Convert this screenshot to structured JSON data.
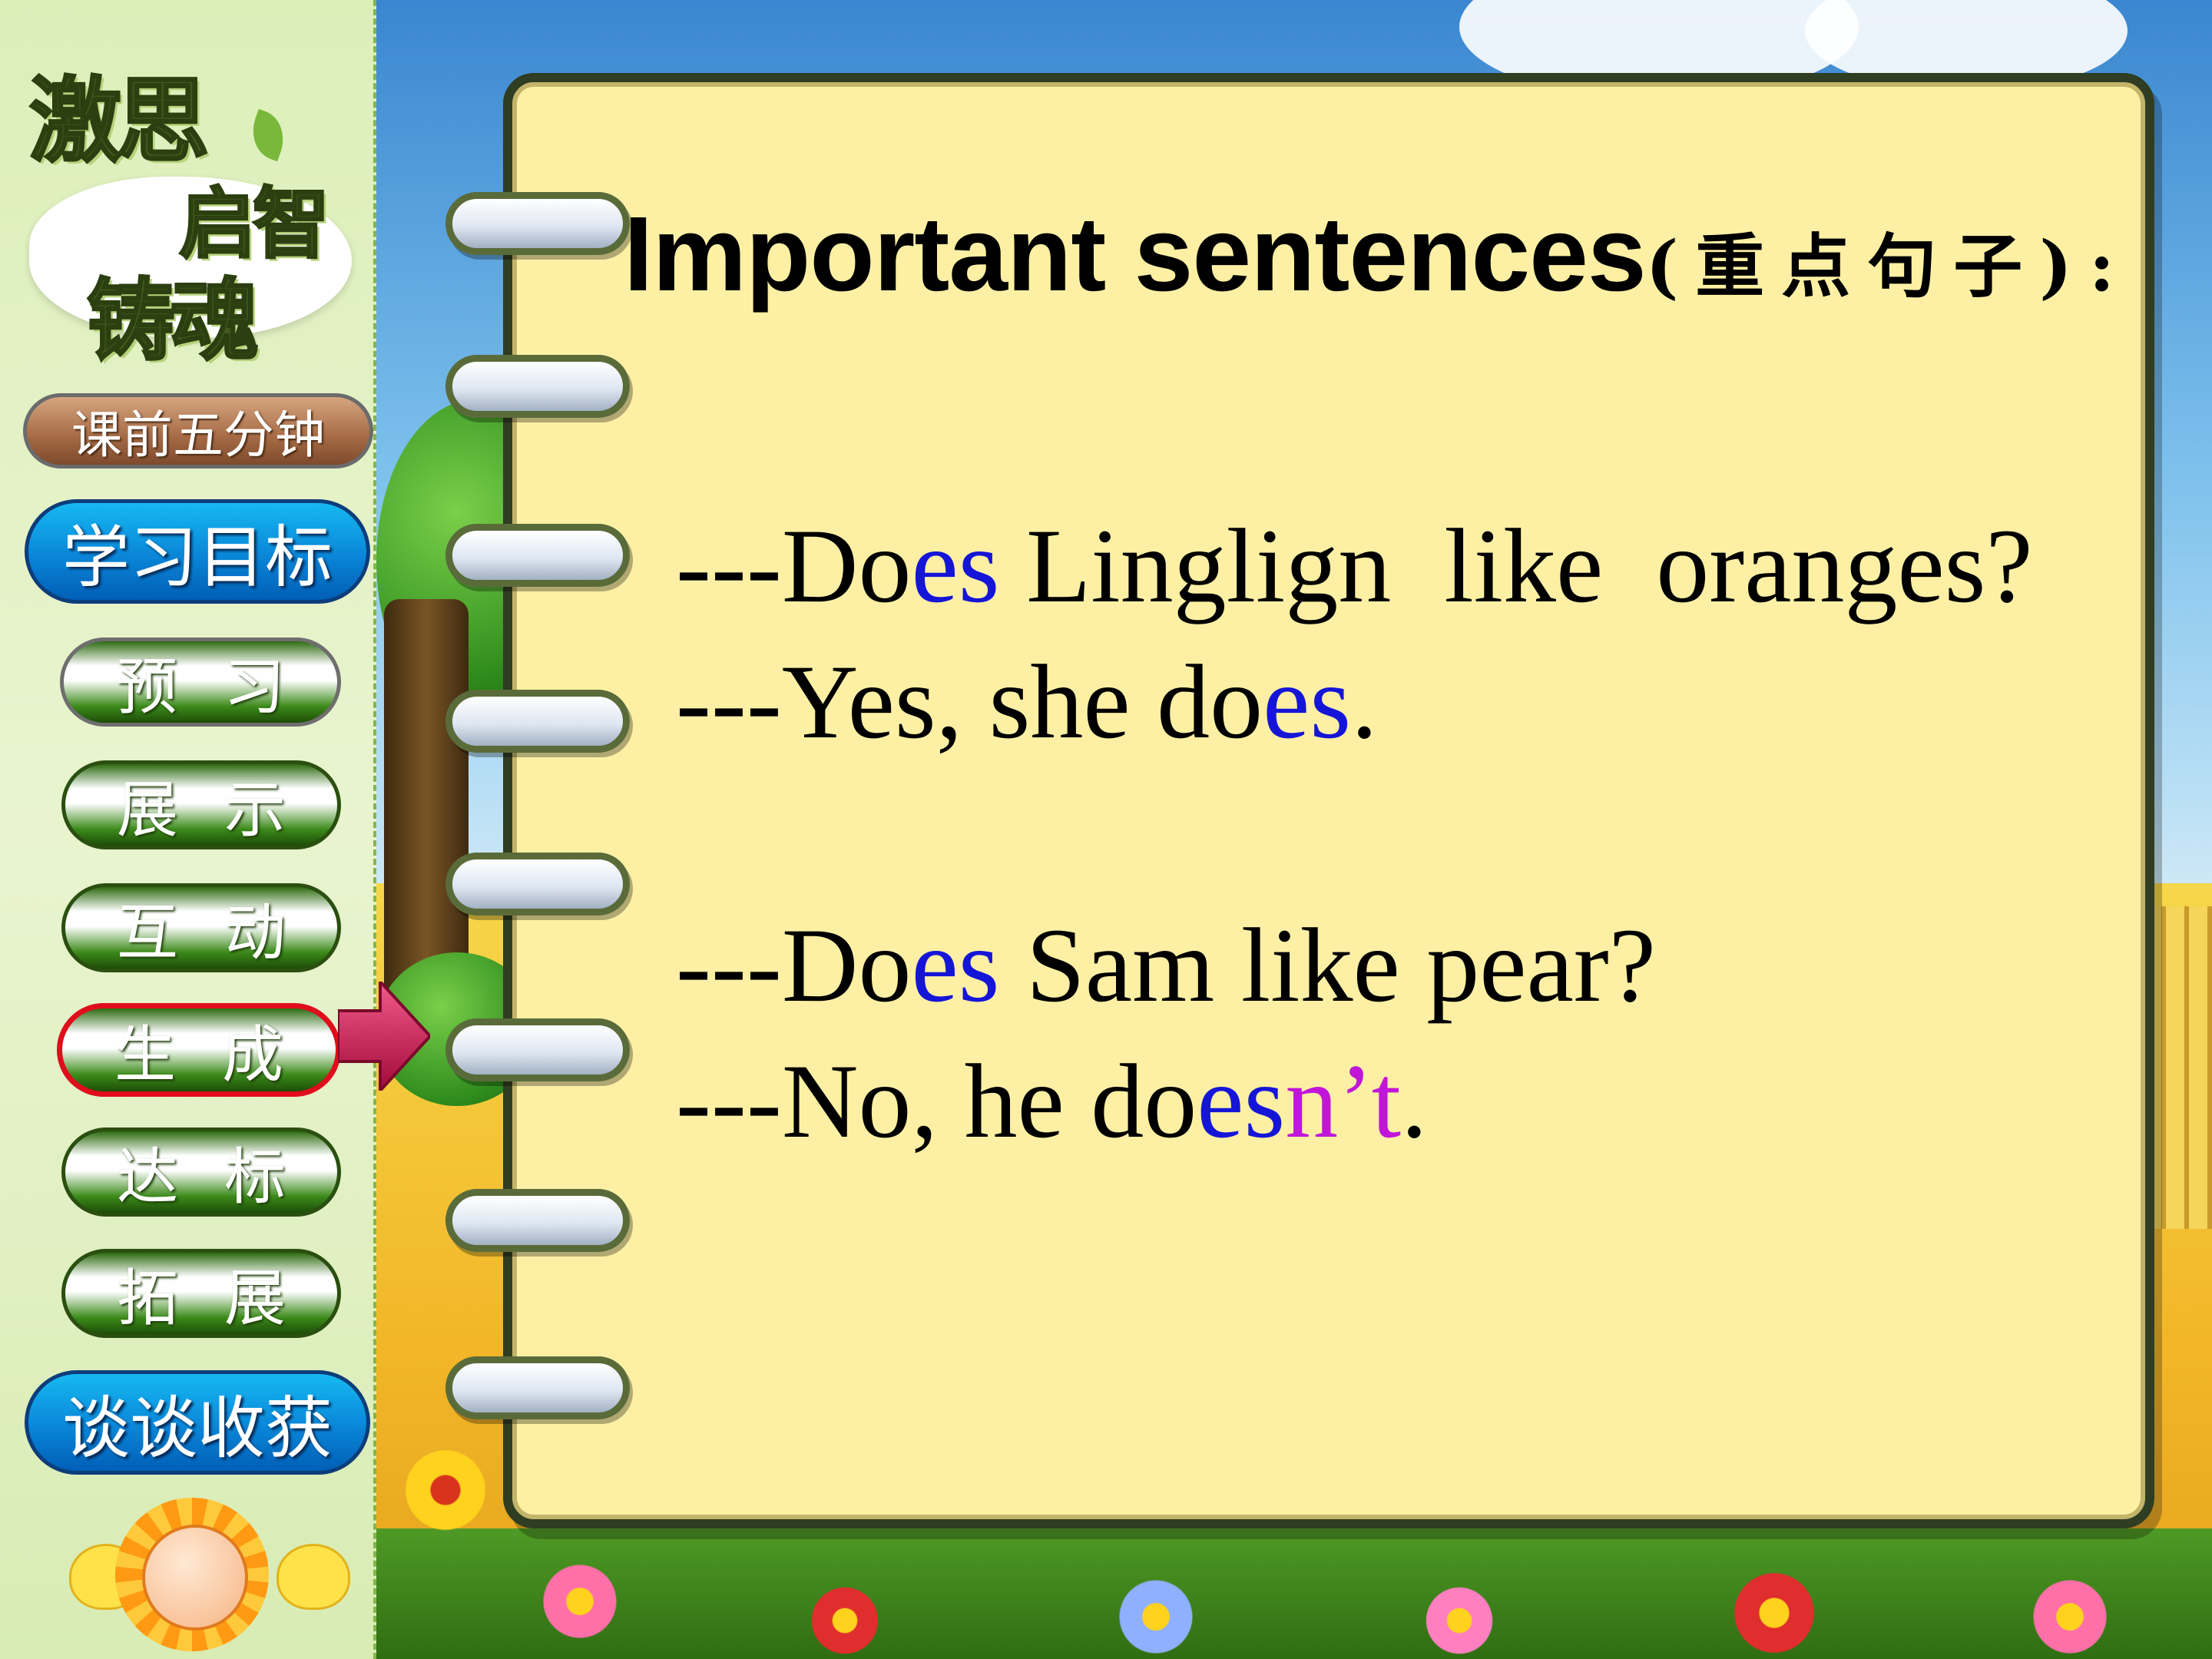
{
  "sidebar": {
    "logo_line1": "激思",
    "logo_line2": "启智",
    "logo_line3": "铸魂",
    "nav": [
      {
        "label": "课前五分钟"
      },
      {
        "label": "学习目标"
      },
      {
        "label": "预习"
      },
      {
        "label": "展示"
      },
      {
        "label": "互动"
      },
      {
        "label": "生成",
        "active": true
      },
      {
        "label": "达标"
      },
      {
        "label": "拓展"
      },
      {
        "label": "谈谈收获"
      }
    ]
  },
  "slide": {
    "title_en": "Important sentences",
    "title_zh": "(重点句子):",
    "dialog1": {
      "q_prefix": "---Do",
      "q_es": "es",
      "q_rest": " Linglign  like  oranges?",
      "a_prefix": "---Yes, she do",
      "a_es": "es",
      "a_end": "."
    },
    "dialog2": {
      "q_prefix": "---Do",
      "q_es": "es",
      "q_rest": " Sam like pear?",
      "a_prefix": "---No, he do",
      "a_es": "es",
      "a_nt": "n’t",
      "a_end": "."
    }
  },
  "colors": {
    "highlight_blue": "#1515d8",
    "highlight_purple": "#c116d9",
    "active_border": "#e00d1c"
  }
}
